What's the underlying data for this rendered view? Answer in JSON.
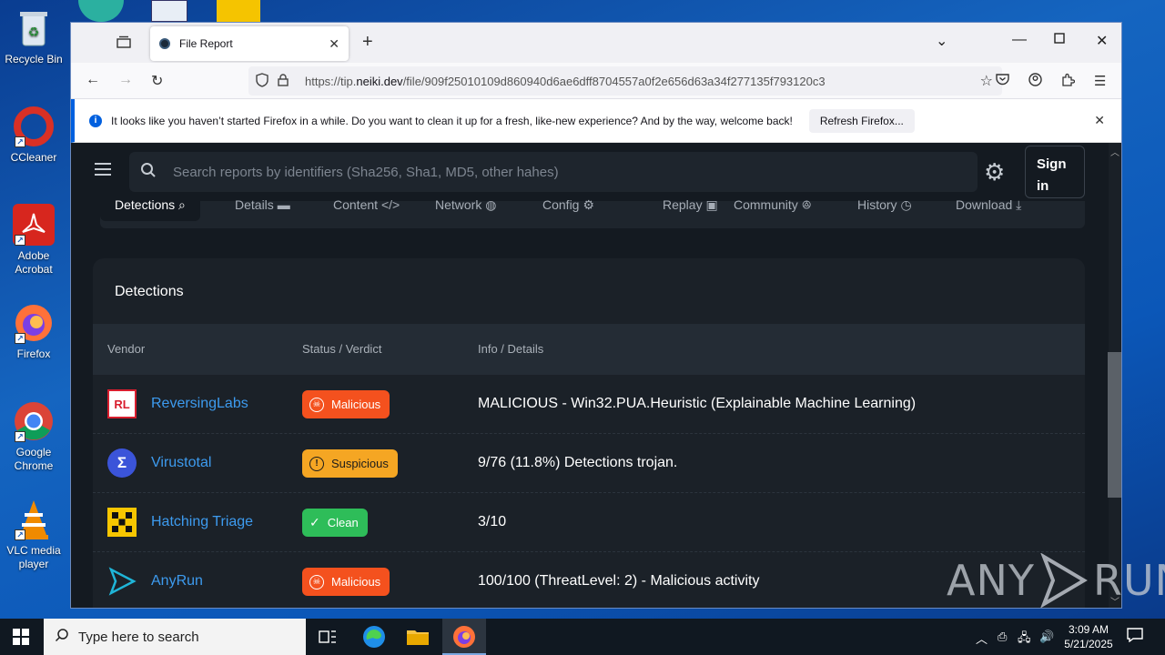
{
  "desktop": {
    "icons": [
      {
        "label": "Recycle Bin",
        "icon": "recycle-bin-icon"
      },
      {
        "label": "CCleaner",
        "icon": "ccleaner-icon"
      },
      {
        "label": "Adobe Acrobat",
        "icon": "acrobat-icon"
      },
      {
        "label": "Firefox",
        "icon": "firefox-icon"
      },
      {
        "label": "Google Chrome",
        "icon": "chrome-icon"
      },
      {
        "label": "VLC media player",
        "icon": "vlc-icon"
      }
    ]
  },
  "browser": {
    "tab_title": "File Report",
    "url_prefix": "https://tip.",
    "url_domain": "neiki.dev",
    "url_path": "/file/909f25010109d860940d6ae6dff8704557a0f2e656d63a34f277135f793120c3",
    "notification": {
      "text": "It looks like you haven’t started Firefox in a while. Do you want to clean it up for a fresh, like-new experience? And by the way, welcome back!",
      "button": "Refresh Firefox..."
    }
  },
  "app": {
    "search_placeholder": "Search reports by identifiers (Sha256, Sha1, MD5, other hahes)",
    "signin_line1": "Sign",
    "signin_line2": "in",
    "tabs": [
      {
        "label": "Detections",
        "icon": "search-icon",
        "active": true
      },
      {
        "label": "Details",
        "icon": "folder-icon",
        "active": false
      },
      {
        "label": "Content",
        "icon": "code-icon",
        "active": false
      },
      {
        "label": "Network",
        "icon": "globe-icon",
        "active": false
      },
      {
        "label": "Config",
        "icon": "config-icon",
        "active": false
      },
      {
        "label": "Replay",
        "icon": "replay-icon",
        "active": false
      },
      {
        "label": "Community",
        "icon": "community-icon",
        "active": false
      },
      {
        "label": "History",
        "icon": "clock-icon",
        "active": false
      },
      {
        "label": "Download",
        "icon": "download-icon",
        "active": false
      }
    ],
    "detections": {
      "title": "Detections",
      "columns": [
        "Vendor",
        "Status / Verdict",
        "Info / Details"
      ],
      "rows": [
        {
          "vendor": "ReversingLabs",
          "logo": "RL",
          "verdict": "Malicious",
          "info": "MALICIOUS - Win32.PUA.Heuristic (Explainable Machine Learning)"
        },
        {
          "vendor": "Virustotal",
          "logo": "Σ",
          "verdict": "Suspicious",
          "info": "9/76 (11.8%) Detections trojan."
        },
        {
          "vendor": "Hatching Triage",
          "logo": "",
          "verdict": "Clean",
          "info": "3/10"
        },
        {
          "vendor": "AnyRun",
          "logo": "",
          "verdict": "Malicious",
          "info": "100/100 (ThreatLevel: 2) - Malicious activity"
        }
      ]
    },
    "colors": {
      "malicious": "#f4511e",
      "suspicious": "#f5a623",
      "clean": "#2ebd59",
      "link": "#3d9bef"
    }
  },
  "watermark": {
    "left": "ANY",
    "right": "RUN"
  },
  "taskbar": {
    "search_placeholder": "Type here to search",
    "time": "3:09 AM",
    "date": "5/21/2025"
  }
}
